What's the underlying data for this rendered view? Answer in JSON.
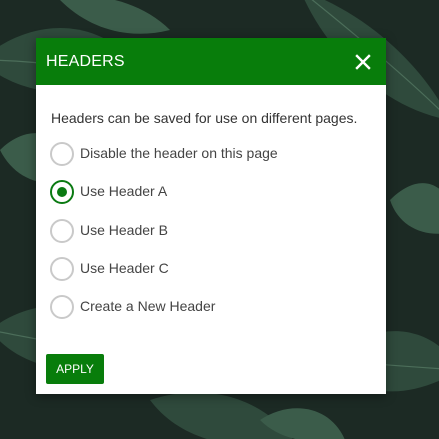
{
  "dialog": {
    "title": "HEADERS",
    "intro": "Headers can be saved for use on different pages.",
    "options": [
      {
        "label": "Disable the header on this page",
        "selected": false
      },
      {
        "label": "Use Header A",
        "selected": true
      },
      {
        "label": "Use Header B",
        "selected": false
      },
      {
        "label": "Use Header C",
        "selected": false
      },
      {
        "label": "Create a New Header",
        "selected": false
      }
    ],
    "apply_label": "APPLY",
    "close_icon": "close-icon"
  },
  "colors": {
    "accent": "#087d0b",
    "background": "#1c2a24"
  }
}
